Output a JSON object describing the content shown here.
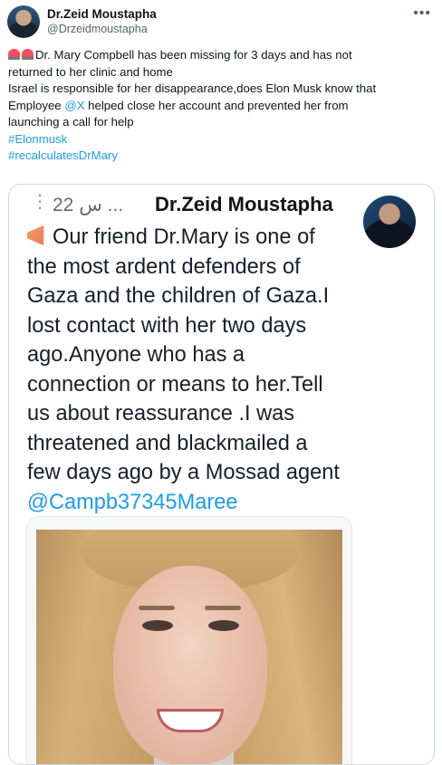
{
  "header": {
    "display_name": "Dr.Zeid Moustapha",
    "handle": "@Drzeidmoustapha",
    "more_icon": "more-icon"
  },
  "post": {
    "line1": "Dr. Mary Compbell has been missing for 3 days and has not",
    "line2": "returned to her clinic and home",
    "line3": "Israel is responsible for her disappearance,does Elon Musk know that",
    "line4_pre": "Employee ",
    "line4_mention": "@X",
    "line4_post": " helped close her account and prevented her from",
    "line5": "launching a call for help",
    "hashtag1": "#Elonmusk",
    "hashtag2": "#recalculatesDrMary",
    "emoji_icon": "rotating-light-icon"
  },
  "quoted": {
    "time": "22 س ...",
    "dots": "⋮",
    "name": "Dr.Zeid Moustapha",
    "lines": [
      "Our friend Dr.Mary is one of",
      "the most ardent defenders of",
      "Gaza and the children of Gaza.I",
      "lost contact with her two days",
      "ago.Anyone who has a",
      "connection or means to her.Tell",
      "us about reassurance .I was",
      "threatened and blackmailed a",
      "few days ago by a Mossad agent"
    ],
    "mention": "@Campb37345Maree",
    "megaphone_icon": "megaphone-icon"
  },
  "colors": {
    "link": "#1d9bf0",
    "text": "#0f1419",
    "secondary": "#536471",
    "border": "#cfd9de"
  }
}
